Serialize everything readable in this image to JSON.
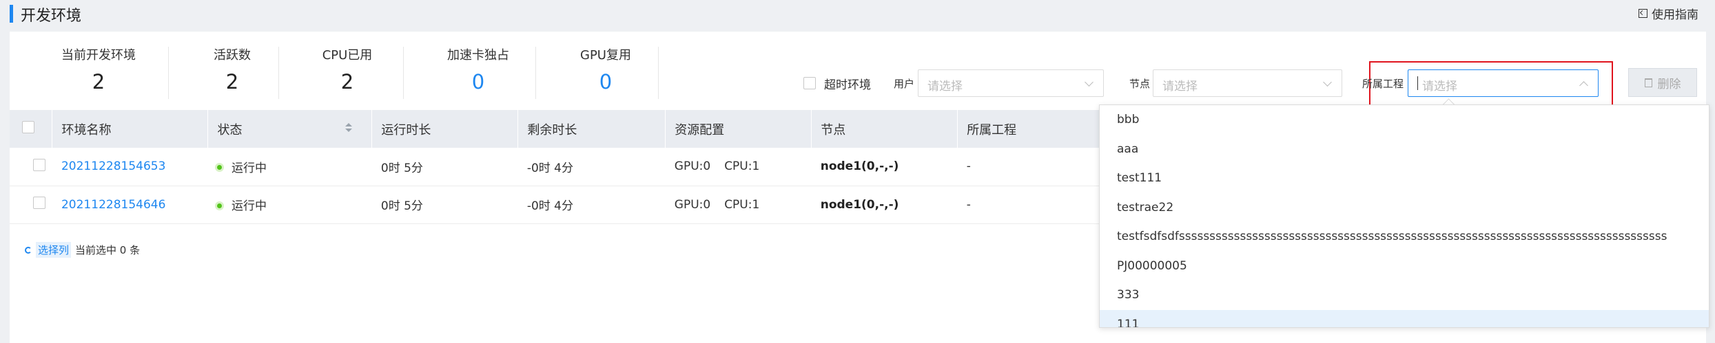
{
  "page": {
    "title": "开发环境",
    "guide": "使用指南"
  },
  "stats": [
    {
      "label": "当前开发环境",
      "value": "2",
      "accent": false
    },
    {
      "label": "活跃数",
      "value": "2",
      "accent": false
    },
    {
      "label": "CPU已用",
      "value": "2",
      "accent": false
    },
    {
      "label": "加速卡独占",
      "value": "0",
      "accent": true
    },
    {
      "label": "GPU复用",
      "value": "0",
      "accent": true
    }
  ],
  "filters": {
    "timeout_label": "超时环境",
    "user_label": "用户",
    "user_placeholder": "请选择",
    "node_label": "节点",
    "node_placeholder": "请选择",
    "project_label": "所属工程",
    "project_placeholder": "请选择",
    "delete_label": "删除"
  },
  "table": {
    "columns": [
      "环境名称",
      "状态",
      "运行时长",
      "剩余时长",
      "资源配置",
      "节点",
      "所属工程"
    ],
    "rows": [
      {
        "name": "20211228154653",
        "status": "运行中",
        "run": "0时 5分",
        "remain": "-0时 4分",
        "gpu": "GPU:0",
        "cpu": "CPU:1",
        "node": "node1(0,-,-)",
        "project": "-"
      },
      {
        "name": "20211228154646",
        "status": "运行中",
        "run": "0时 5分",
        "remain": "-0时 4分",
        "gpu": "GPU:0",
        "cpu": "CPU:1",
        "node": "node1(0,-,-)",
        "project": "-"
      }
    ]
  },
  "footer": {
    "select_cols": "选择列",
    "selected": "当前选中 0 条"
  },
  "dropdown_options": [
    "bbb",
    "aaa",
    "test111",
    "testrae22",
    "testfsdfsdfssssssssssssssssssssssssssssssssssssssssssssssssssssssssssssssssssssssssssssssss",
    "PJ00000005",
    "333",
    "111"
  ],
  "colors": {
    "accent": "#1e87f0",
    "highlight": "#e0141e",
    "status_running": "#52c41a"
  }
}
